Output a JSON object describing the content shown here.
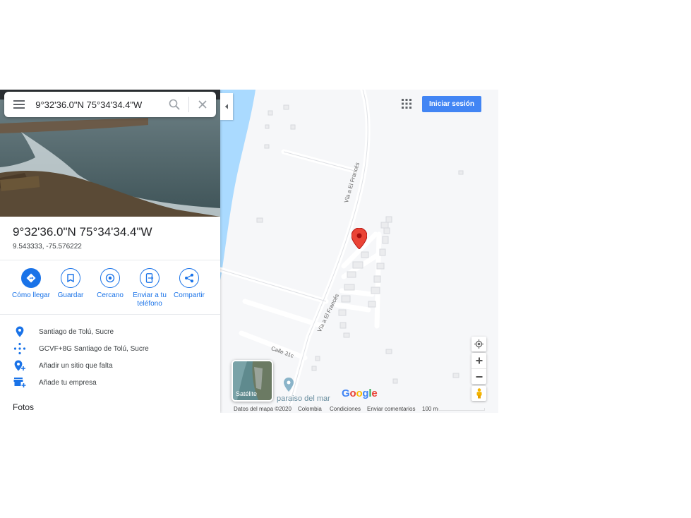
{
  "search": {
    "value": "9°32'36.0\"N 75°34'34.4\"W"
  },
  "place": {
    "title": "9°32'36.0\"N 75°34'34.4\"W",
    "coords": "9.543333, -75.576222"
  },
  "actions": [
    {
      "label": "Cómo llegar",
      "icon": "directions-icon"
    },
    {
      "label": "Guardar",
      "icon": "bookmark-icon"
    },
    {
      "label": "Cercano",
      "icon": "nearby-icon"
    },
    {
      "label": "Enviar a tu teléfono",
      "icon": "send-to-phone-icon"
    },
    {
      "label": "Compartir",
      "icon": "share-icon"
    }
  ],
  "info": [
    {
      "text": "Santiago de Tolú, Sucre",
      "icon": "location-pin-icon"
    },
    {
      "text": "GCVF+8G Santiago de Tolú, Sucre",
      "icon": "plus-code-icon"
    },
    {
      "text": "Añadir un sitio que falta",
      "icon": "add-place-icon"
    },
    {
      "text": "Añade tu empresa",
      "icon": "add-business-icon"
    }
  ],
  "photos_label": "Fotos",
  "header": {
    "signin_label": "Iniciar sesión"
  },
  "map": {
    "road_labels": [
      "Vía a El Francés",
      "Vía a El Francés",
      "Calle 31c"
    ],
    "poi_label": "paraiso del mar",
    "satellite_label": "Satélite",
    "logo": [
      "G",
      "o",
      "o",
      "g",
      "l",
      "e"
    ],
    "attribution": [
      "Datos del mapa ©2020",
      "Colombia",
      "Condiciones",
      "Enviar comentarios",
      "100 m"
    ]
  },
  "colors": {
    "accent": "#1a73e8",
    "pin": "#ea4335",
    "water": "#aadaff",
    "signin": "#4285f4"
  }
}
